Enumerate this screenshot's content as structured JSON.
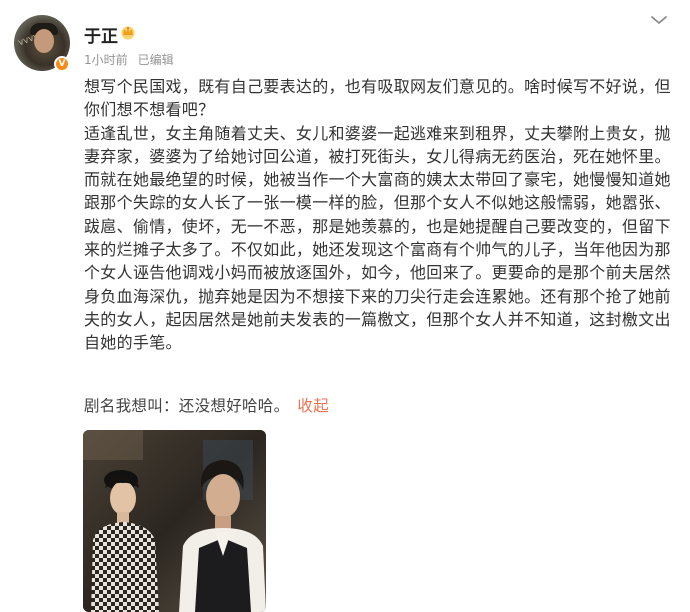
{
  "post": {
    "author": "于正",
    "time": "1小时前",
    "edited": "已编辑",
    "paragraphs": [
      "想写个民国戏，既有自己要表达的，也有吸取网友们意见的。啥时候写不好说，但\n你们想不想看吧？",
      "适逢乱世，女主角随着丈夫、女儿和婆婆一起逃难来到租界，丈夫攀附上贵女，抛\n妻弃家，婆婆为了给她讨回公道，被打死街头，女儿得病无药医治，死在她怀里。\n而就在她最绝望的时候，她被当作一个大富商的姨太太带回了豪宅，她慢慢知道她\n跟那个失踪的女人长了一张一模一样的脸，但那个女人不似她这般懦弱，她嚣张、\n跋扈、偷情，使坏，无一不恶，那是她羡慕的，也是她提醒自己要改变的，但留下\n来的烂摊子太多了。不仅如此，她还发现这个富商有个帅气的儿子，当年他因为那\n个女人诬告他调戏小妈而被放逐国外，如今，他回来了。更要命的是那个前夫居然\n身负血海深仇，抛弃她是因为不想接下来的刀尖行走会连累她。还有那个抢了她前\n夫的女人，起因居然是她前夫发表的一篇檄文，但那个女人并不知道，这封檄文出\n自她的手笔。"
    ],
    "drama_name": "剧名我想叫：还没想好哈哈。",
    "collapse_label": "收起"
  },
  "colors": {
    "text": "#333333",
    "meta": "#939393",
    "link": "#eb7350",
    "verified": "#f98a13"
  },
  "icons": [
    "avatar",
    "verified-badge-icon",
    "crown-icon",
    "more-options-icon",
    "photo"
  ]
}
